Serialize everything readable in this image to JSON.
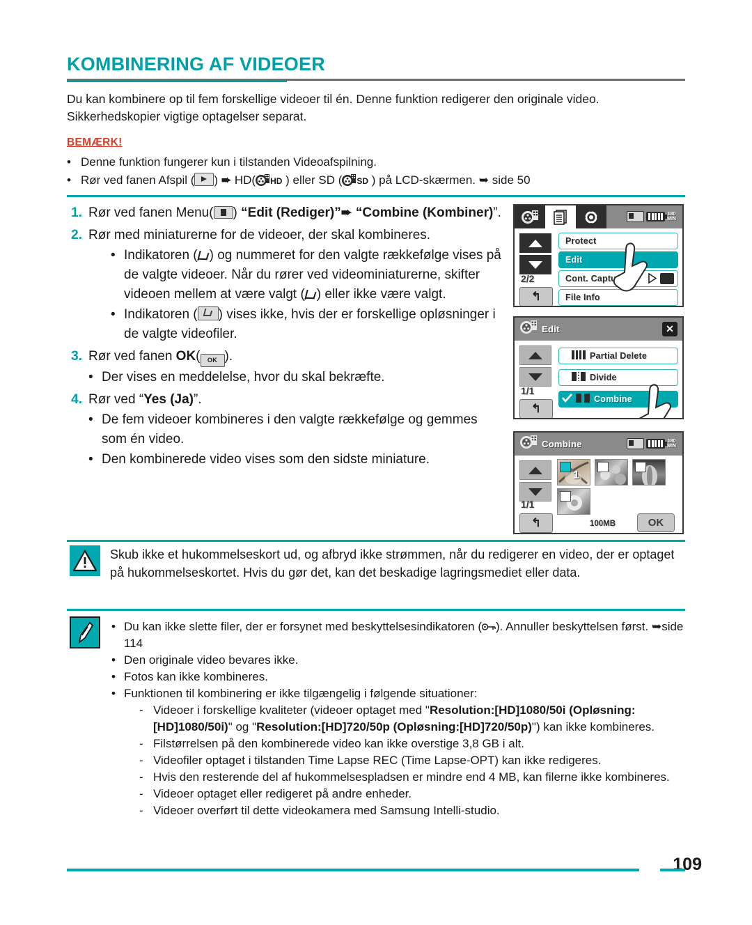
{
  "document": {
    "title": "KOMBINERING AF VIDEOER",
    "page_number": "109",
    "intro": "Du kan kombinere op til fem forskellige videoer til én. Denne funktion redigerer den originale video. Sikkerhedskopier vigtige optagelser separat."
  },
  "note": {
    "heading": "BEMÆRK!",
    "bullet_glyph": "•",
    "items": [
      {
        "text": "Denne funktion fungerer kun i tilstanden Videoafspilning."
      }
    ],
    "item2": {
      "part1": "Rør ved fanen Afspil (",
      "part2": ") ",
      "arrow": "➨",
      "part3": " HD(",
      "hd": "HD",
      "part4": " ) eller SD (",
      "sd": "SD",
      "part5": " ) på LCD-skærmen. ",
      "arrow2": "➥",
      "part6": " side 50"
    }
  },
  "steps": [
    {
      "num": "1.",
      "pre": "Rør ved fanen Menu(",
      "post": ") ",
      "bold1": "“Edit (Rediger)”",
      "arrow": "➨",
      "bold2": " “Combine (Kombiner)",
      "tail": "”."
    },
    {
      "num": "2.",
      "text": "Rør med miniaturerne for de videoer, der skal kombineres.",
      "subs": [
        {
          "pre": "Indikatoren (",
          "mid": ") og nummeret for den valgte rækkefølge vises på de valgte videoer. Når du rører ved videominiaturerne, skifter videoen mellem at være valgt (",
          "post": ") eller ikke være valgt."
        },
        {
          "pre": "Indikatoren (",
          "post": ") vises ikke, hvis der er forskellige opløsninger i de valgte videofiler."
        }
      ]
    },
    {
      "num": "3.",
      "pre": "Rør ved fanen ",
      "bold": "OK",
      "paren_open": "(",
      "ok_label": "OK",
      "paren_close": ").",
      "subs": [
        {
          "text": "Der vises en meddelelse, hvor du skal bekræfte."
        }
      ]
    },
    {
      "num": "4.",
      "pre": "Rør ved “",
      "bold": "Yes (Ja)",
      "tail": "”.",
      "subs": [
        {
          "text": "De fem videoer kombineres i den valgte rækkefølge og gemmes som én video."
        },
        {
          "text": "Den kombinerede video vises som den sidste miniature."
        }
      ]
    }
  ],
  "lcd1": {
    "name": "menu-screen",
    "battery_minutes": "180",
    "battery_unit": "MIN",
    "page_counter": "2/2",
    "back_glyph": "↰",
    "rows": [
      {
        "label": "Protect",
        "selected": false
      },
      {
        "label": "Edit",
        "selected": true
      },
      {
        "label": "Cont. Capture",
        "selected": false
      },
      {
        "label": "File Info",
        "selected": false
      }
    ]
  },
  "lcd2": {
    "name": "edit-screen",
    "title": "Edit",
    "close_glyph": "✕",
    "page_counter": "1/1",
    "back_glyph": "↰",
    "rows": [
      {
        "label": "Partial Delete",
        "selected": false
      },
      {
        "label": "Divide",
        "selected": false
      },
      {
        "label": "Combine",
        "selected": true
      }
    ]
  },
  "lcd3": {
    "name": "combine-screen",
    "title": "Combine",
    "battery_minutes": "180",
    "battery_unit": "MIN",
    "page_counter": "1/1",
    "back_glyph": "↰",
    "size_label": "100MB",
    "ok_label": "OK",
    "thumbnails": [
      {
        "checked": true,
        "order": "1"
      },
      {
        "checked": false,
        "order": ""
      },
      {
        "checked": false,
        "order": ""
      },
      {
        "checked": false,
        "order": ""
      }
    ]
  },
  "caution": {
    "glyph": "!",
    "text": "Skub ikke et hukommelseskort ud, og afbryd ikke strømmen, når du redigerer en video, der er optaget på hukommelseskortet. Hvis du gør det, kan det beskadige lagringsmediet eller data."
  },
  "tips": {
    "bullet_glyph": "•",
    "dash_glyph": "-",
    "item1": {
      "pre": "Du kan ikke slette filer, der er forsynet med beskyttelsesindikatoren (",
      "post": "). Annuller beskyttelsen først. ",
      "arrow": "➥",
      "tail": "side 114"
    },
    "items": [
      "Den originale video bevares ikke.",
      "Fotos kan ikke kombineres.",
      "Funktionen til kombinering er ikke tilgængelig i følgende situationer:"
    ],
    "sub_item1": {
      "pre": "Videoer i forskellige kvaliteter (videoer optaget med \"",
      "bold": "Resolution:[HD]1080/50i (Opløsning:[HD]1080/50i)",
      "mid": "\" og \"",
      "bold2": "Resolution:[HD]720/50p (Opløsning:[HD]720/50p)",
      "tail": "\") kan ikke kombineres."
    },
    "sub_items": [
      "Filstørrelsen på den kombinerede video kan ikke overstige 3,8 GB i alt.",
      "Videofiler optaget i tilstanden Time Lapse REC (Time Lapse-OPT) kan ikke redigeres.",
      "Hvis den resterende del af hukommelsespladsen er mindre end 4 MB, kan filerne ikke kombineres.",
      "Videoer optaget eller redigeret på andre enheder.",
      "Videoer overført til dette videokamera med Samsung Intelli-studio."
    ]
  },
  "colors": {
    "accent_teal": "#00a8b0",
    "title_teal": "#00a0a8",
    "note_red": "#d43f2a"
  }
}
